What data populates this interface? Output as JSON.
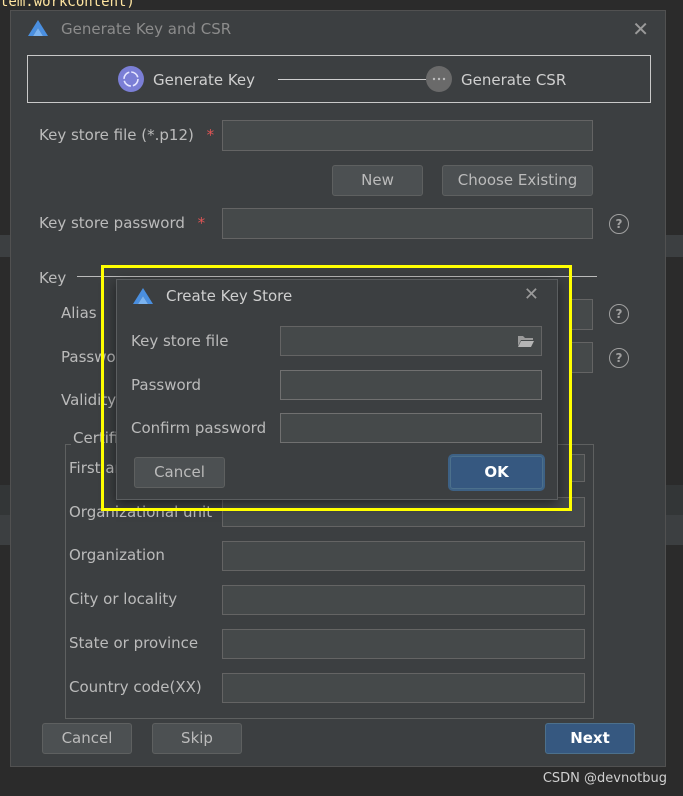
{
  "background": {
    "code_snippet": "tem.workContent)"
  },
  "dialog": {
    "title": "Generate Key and CSR",
    "steps": [
      {
        "label": "Generate Key"
      },
      {
        "label": "Generate CSR"
      }
    ],
    "key_store_file_label": "Key store file (*.p12)",
    "key_store_password_label": "Key store password",
    "required_mark": "*",
    "new_button": "New",
    "choose_existing_button": "Choose Existing",
    "key_section_label": "Key",
    "alias_label": "Alias",
    "password_label": "Passwo",
    "validity_label": "Validity",
    "cert_legend": "Certifi",
    "first_name_label": "First ar",
    "org_unit_label": "Organizational unit",
    "organization_label": "Organization",
    "city_label": "City or locality",
    "state_label": "State or province",
    "country_label": "Country code(XX)",
    "cancel_button": "Cancel",
    "skip_button": "Skip",
    "next_button": "Next",
    "help_glyph": "?"
  },
  "modal": {
    "title": "Create Key Store",
    "key_store_file_label": "Key store file",
    "password_label": "Password",
    "confirm_password_label": "Confirm password",
    "cancel_button": "Cancel",
    "ok_button": "OK"
  },
  "watermark": "CSDN @devnotbug",
  "colors": {
    "highlight": "#ffff00",
    "primary_button": "#365880",
    "required": "#e05555"
  }
}
